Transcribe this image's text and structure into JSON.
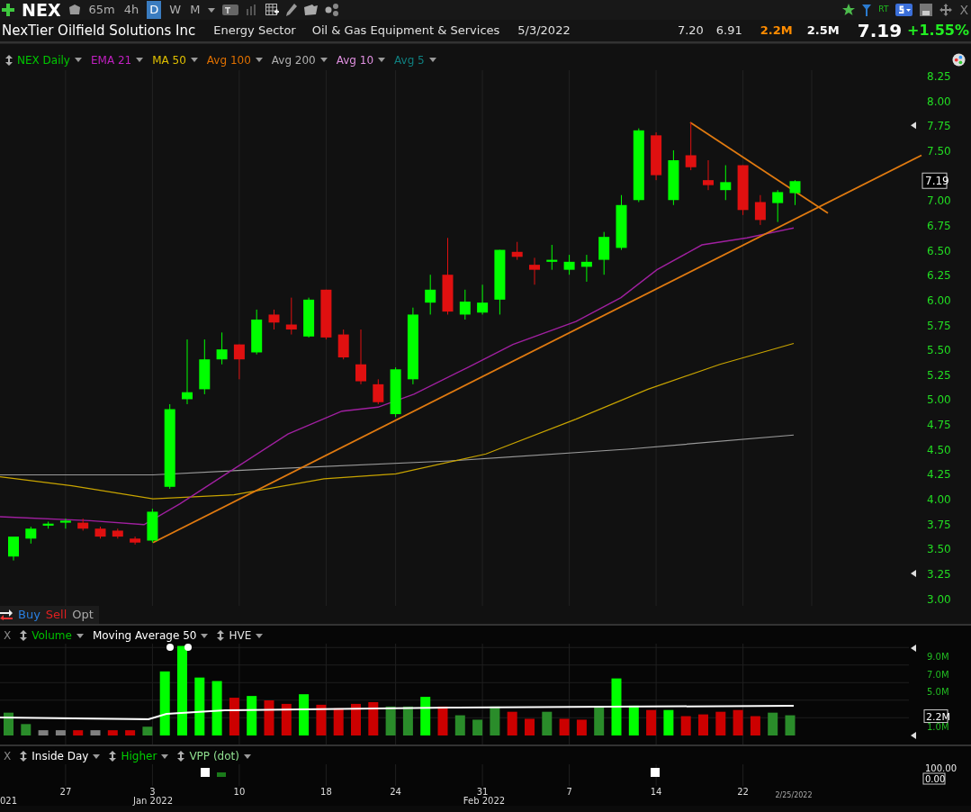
{
  "toolbar": {
    "symbol": "NEX",
    "timeframes": [
      {
        "label": "65m",
        "selected": false
      },
      {
        "label": "4h",
        "selected": false
      },
      {
        "label": "D",
        "selected": true
      },
      {
        "label": "W",
        "selected": false
      },
      {
        "label": "M",
        "selected": false
      }
    ],
    "rt_label": "RT",
    "close_label": "X"
  },
  "quote": {
    "company": "NexTier Oilfield Solutions Inc",
    "sector": "Energy Sector",
    "industry": "Oil & Gas Equipment & Services",
    "date": "5/3/2022",
    "high": "7.20",
    "low": "6.91",
    "volume": "2.2M",
    "avg_volume": "2.5M",
    "price": "7.19",
    "change": "+1.55%"
  },
  "price_pane": {
    "studies": [
      {
        "label": "NEX Daily",
        "color": "#00c800",
        "draggable": true
      },
      {
        "label": "EMA 21",
        "color": "#c020c0",
        "draggable": false
      },
      {
        "label": "MA 50",
        "color": "#e0c000",
        "draggable": false
      },
      {
        "label": "Avg 100",
        "color": "#e07000",
        "draggable": false
      },
      {
        "label": "Avg 200",
        "color": "#b0b0b0",
        "draggable": false
      },
      {
        "label": "Avg 10",
        "color": "#e090e0",
        "draggable": false
      },
      {
        "label": "Avg 5",
        "color": "#108080",
        "draggable": false
      }
    ],
    "axis_ticks": [
      "8.25",
      "8.00",
      "7.75",
      "7.50",
      "7.00",
      "6.75",
      "6.50",
      "6.25",
      "6.00",
      "5.75",
      "5.50",
      "5.25",
      "5.00",
      "4.75",
      "4.50",
      "4.25",
      "4.00",
      "3.75",
      "3.50",
      "3.25",
      "3.00"
    ],
    "last_price_label": "7.19"
  },
  "trade_bar": {
    "buy": "Buy",
    "sell": "Sell",
    "options": "Opt"
  },
  "volume_pane": {
    "close_label": "X",
    "studies": [
      {
        "label": "Volume",
        "color": "#00c000",
        "draggable": true
      },
      {
        "label": "Moving Average 50",
        "color": "#ffffff",
        "draggable": false
      },
      {
        "label": "HVE",
        "color": "#e0e0e0",
        "draggable": true
      }
    ],
    "axis_ticks": [
      "9.0M",
      "7.0M",
      "5.0M",
      "1.0M"
    ],
    "last_volume_label": "2.2M"
  },
  "signal_pane": {
    "close_label": "X",
    "studies": [
      {
        "label": "Inside Day",
        "color": "#ffffff",
        "draggable": true
      },
      {
        "label": "Higher",
        "color": "#00d000",
        "draggable": true
      },
      {
        "label": "VPP (dot)",
        "color": "#90e090",
        "draggable": true
      }
    ],
    "axis_ticks": [
      "100.00"
    ],
    "last_value_label": "0.00"
  },
  "date_axis": {
    "days": [
      "27",
      "3",
      "10",
      "18",
      "24",
      "31",
      "7",
      "14",
      "22"
    ],
    "months": [
      "021",
      "Jan 2022",
      "Feb 2022"
    ],
    "last_date": "2/25/2022"
  }
}
